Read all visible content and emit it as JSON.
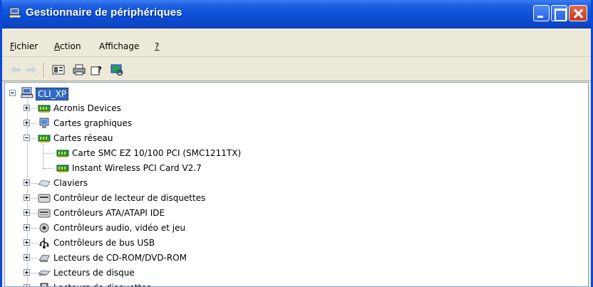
{
  "window": {
    "title": "Gestionnaire de périphériques"
  },
  "menu": {
    "items": [
      {
        "label_first": "F",
        "label_rest": "ichier"
      },
      {
        "label_first": "A",
        "label_rest": "ction"
      },
      {
        "label_first": "Aff",
        "label_rest": "ichage"
      },
      {
        "label_first": "?",
        "label_rest": ""
      }
    ]
  },
  "toolbar": {
    "buttons": [
      "back-arrow-icon",
      "forward-arrow-icon",
      "properties-icon",
      "print-icon",
      "help-icon",
      "scan-hardware-icon"
    ]
  },
  "tree": {
    "root": "CLI_XP",
    "items": [
      {
        "label": "Acronis Devices",
        "icon": "network-card-icon",
        "expander": "+"
      },
      {
        "label": "Cartes graphiques",
        "icon": "display-adapter-icon",
        "expander": "+"
      },
      {
        "label": "Cartes réseau",
        "icon": "network-card-icon",
        "expander": "-"
      },
      {
        "label": "Carte SMC EZ 10/100 PCI (SMC1211TX)",
        "icon": "network-card-icon",
        "child": true
      },
      {
        "label": "Instant Wireless PCI Card V2.7",
        "icon": "network-card-icon",
        "child": true
      },
      {
        "label": "Claviers",
        "icon": "keyboard-icon",
        "expander": "+"
      },
      {
        "label": "Contrôleur de lecteur de disquettes",
        "icon": "floppy-controller-icon",
        "expander": "+"
      },
      {
        "label": "Contrôleurs ATA/ATAPI IDE",
        "icon": "ide-controller-icon",
        "expander": "+"
      },
      {
        "label": "Contrôleurs audio, vidéo et jeu",
        "icon": "audio-icon",
        "expander": "+"
      },
      {
        "label": "Contrôleurs de bus USB",
        "icon": "usb-icon",
        "expander": "+"
      },
      {
        "label": "Lecteurs de CD-ROM/DVD-ROM",
        "icon": "cdrom-icon",
        "expander": "+"
      },
      {
        "label": "Lecteurs de disque",
        "icon": "disk-drive-icon",
        "expander": "+"
      },
      {
        "label": "Lecteurs de disquettes",
        "icon": "floppy-drive-icon",
        "expander": "+"
      }
    ]
  },
  "colors": {
    "titlebar": "#0a4fd6",
    "selection": "#316ac5"
  }
}
